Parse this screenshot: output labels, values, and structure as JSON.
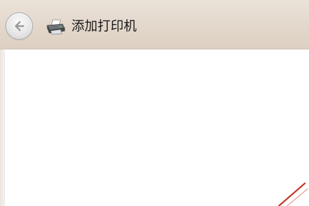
{
  "window": {
    "title": "添加打印机"
  },
  "icons": {
    "back": "back-arrow-icon",
    "printer": "printer-icon"
  },
  "colors": {
    "header_bg": "#e3d7cb",
    "annotation": "#c0392b"
  }
}
